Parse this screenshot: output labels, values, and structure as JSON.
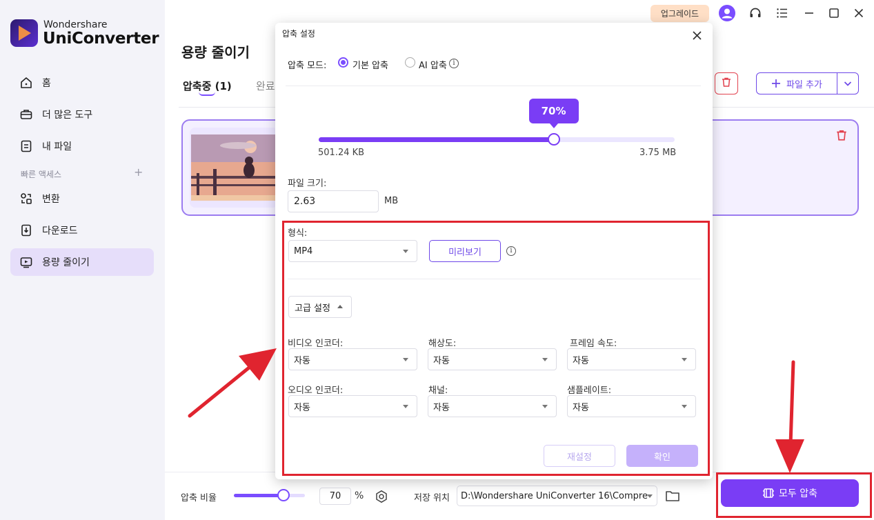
{
  "brand": {
    "top": "Wondershare",
    "main": "UniConverter"
  },
  "sidebar": {
    "items": [
      {
        "label": "홈",
        "icon": "home-icon"
      },
      {
        "label": "더 많은 도구",
        "icon": "toolbox-icon"
      },
      {
        "label": "내 파일",
        "icon": "file-icon"
      },
      {
        "label": "변환",
        "icon": "convert-icon"
      },
      {
        "label": "다운로드",
        "icon": "download-icon"
      },
      {
        "label": "용량 줄이기",
        "icon": "compress-icon",
        "active": true
      }
    ],
    "quick_access_label": "빠른 액세스",
    "quick_access_add": "+"
  },
  "topbar": {
    "upgrade_label": "업그레이드"
  },
  "main": {
    "title": "용량 줄이기",
    "tabs": [
      {
        "label": "압축중 (1)",
        "active": true
      },
      {
        "label": "완료"
      }
    ],
    "add_file_label": "파일 추가"
  },
  "bottom": {
    "ratio_label": "압축 비율",
    "ratio_value": "70",
    "ratio_unit": "%",
    "ratio_fraction": 0.7,
    "save_label": "저장 위치",
    "save_path": "D:\\Wondershare UniConverter 16\\Compre",
    "compress_all_label": "모두 압축"
  },
  "dialog": {
    "title": "압축 설정",
    "mode_label": "압축 모드:",
    "mode_options": [
      "기본 압축",
      "AI 압축"
    ],
    "mode_selected": "기본 압축",
    "percent_label": "70%",
    "percent_fraction": 0.66,
    "size_min": "501.24 KB",
    "size_max": "3.75 MB",
    "file_size_label": "파일 크기:",
    "file_size_value": "2.63",
    "file_size_unit": "MB",
    "format_label": "형식:",
    "format_value": "MP4",
    "preview_label": "미리보기",
    "advanced_label": "고급 설정",
    "fields": {
      "video_encoder": {
        "label": "비디오 인코더:",
        "value": "자동"
      },
      "resolution": {
        "label": "해상도:",
        "value": "자동"
      },
      "frame_rate": {
        "label": "프레임 속도:",
        "value": "자동"
      },
      "audio_encoder": {
        "label": "오디오 인코더:",
        "value": "자동"
      },
      "channel": {
        "label": "채널:",
        "value": "자동"
      },
      "sample_rate": {
        "label": "샘플레이트:",
        "value": "자동"
      }
    },
    "reset_label": "재설정",
    "ok_label": "확인"
  },
  "colors": {
    "accent": "#7a3df5",
    "annotation": "#e0242f"
  }
}
